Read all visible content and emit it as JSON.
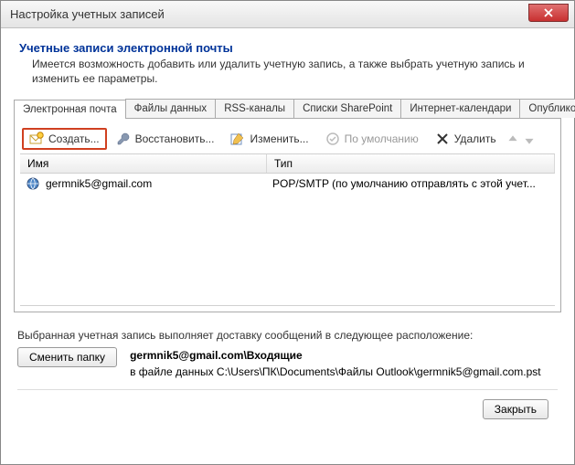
{
  "window": {
    "title": "Настройка учетных записей"
  },
  "header": {
    "title": "Учетные записи электронной почты",
    "subtitle": "Имеется возможность добавить или удалить учетную запись, а также выбрать учетную запись и изменить ее параметры."
  },
  "tabs": [
    "Электронная почта",
    "Файлы данных",
    "RSS-каналы",
    "Списки SharePoint",
    "Интернет-календари",
    "Опубликован"
  ],
  "toolbar": {
    "create": "Создать...",
    "repair": "Восстановить...",
    "edit": "Изменить...",
    "default": "По умолчанию",
    "delete": "Удалить"
  },
  "columns": {
    "name": "Имя",
    "type": "Тип"
  },
  "accounts": [
    {
      "name": "germnik5@gmail.com",
      "type": "POP/SMTP (по умолчанию отправлять с этой учет..."
    }
  ],
  "delivery": {
    "label": "Выбранная учетная запись выполняет доставку сообщений в следующее расположение:",
    "change_button": "Сменить папку",
    "target": "germnik5@gmail.com\\Входящие",
    "path": "в файле данных C:\\Users\\ПК\\Documents\\Файлы Outlook\\germnik5@gmail.com.pst"
  },
  "buttons": {
    "close": "Закрыть"
  }
}
